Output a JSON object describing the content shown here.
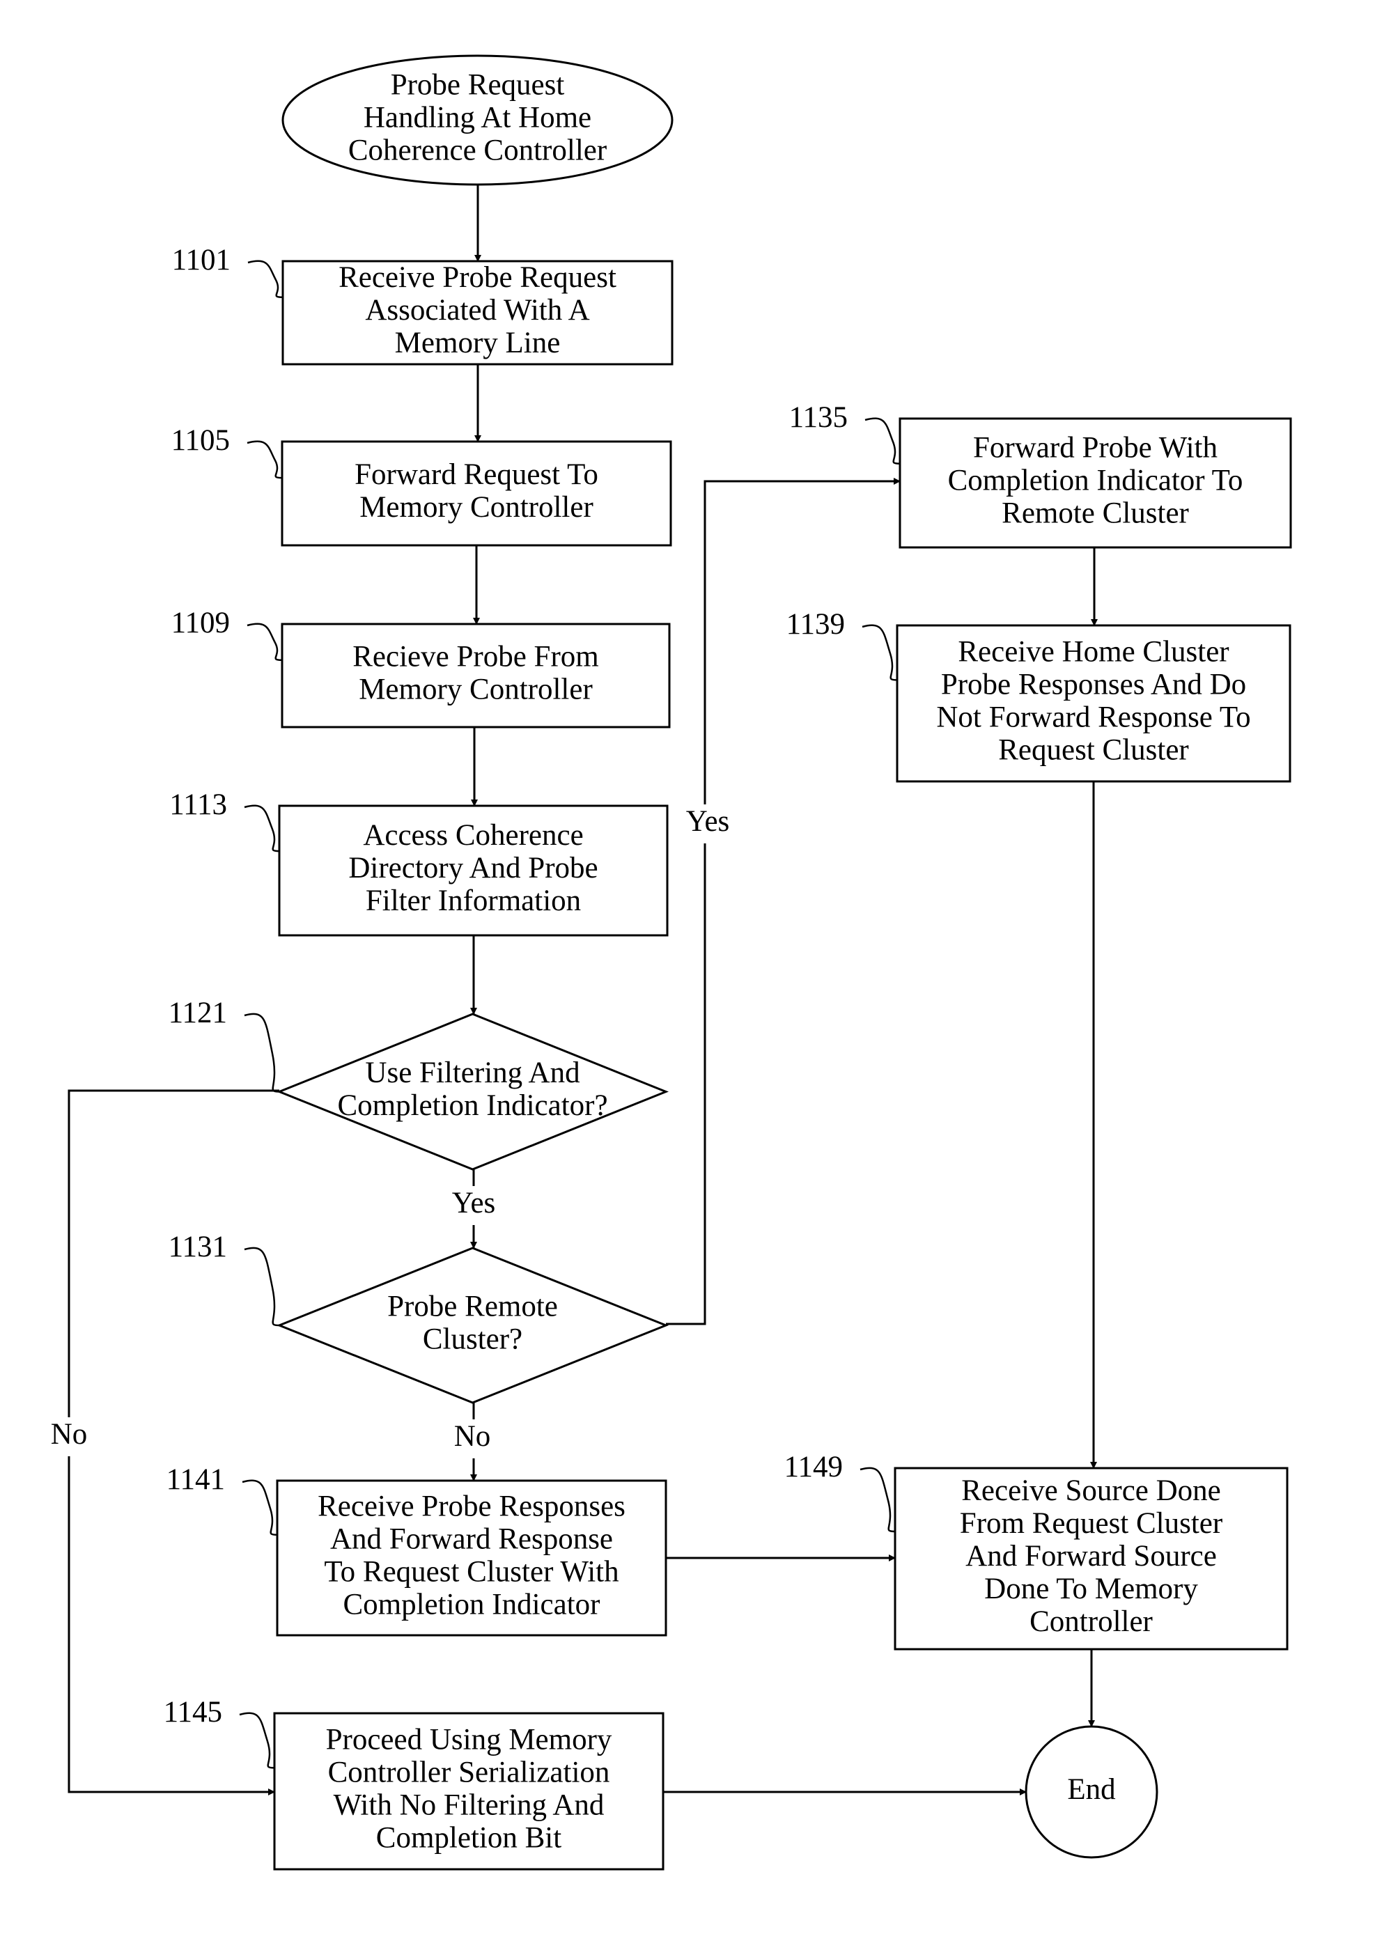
{
  "diagram": {
    "type": "flowchart",
    "nodes": [
      {
        "id": "start",
        "shape": "ellipse",
        "ref": "",
        "lines": [
          "Probe Request",
          "Handling At Home",
          "Coherence Controller"
        ]
      },
      {
        "id": "1101",
        "shape": "rect",
        "ref": "1101",
        "lines": [
          "Receive Probe Request",
          "Associated With A",
          "Memory Line"
        ]
      },
      {
        "id": "1105",
        "shape": "rect",
        "ref": "1105",
        "lines": [
          "Forward Request To",
          "Memory Controller"
        ]
      },
      {
        "id": "1109",
        "shape": "rect",
        "ref": "1109",
        "lines": [
          "Recieve Probe From",
          "Memory Controller"
        ]
      },
      {
        "id": "1113",
        "shape": "rect",
        "ref": "1113",
        "lines": [
          "Access Coherence",
          "Directory And Probe",
          "Filter Information"
        ]
      },
      {
        "id": "1121",
        "shape": "diamond",
        "ref": "1121",
        "lines": [
          "Use Filtering And",
          "Completion Indicator?"
        ]
      },
      {
        "id": "1131",
        "shape": "diamond",
        "ref": "1131",
        "lines": [
          "Probe Remote",
          "Cluster?"
        ]
      },
      {
        "id": "1135",
        "shape": "rect",
        "ref": "1135",
        "lines": [
          "Forward Probe With",
          "Completion Indicator To",
          "Remote Cluster"
        ]
      },
      {
        "id": "1139",
        "shape": "rect",
        "ref": "1139",
        "lines": [
          "Receive Home Cluster",
          "Probe Responses And Do",
          "Not Forward Response To",
          "Request Cluster"
        ]
      },
      {
        "id": "1141",
        "shape": "rect",
        "ref": "1141",
        "lines": [
          "Receive Probe Responses",
          "And Forward Response",
          "To Request Cluster With",
          "Completion Indicator"
        ]
      },
      {
        "id": "1145",
        "shape": "rect",
        "ref": "1145",
        "lines": [
          "Proceed Using Memory",
          "Controller Serialization",
          "With No Filtering And",
          "Completion Bit"
        ]
      },
      {
        "id": "1149",
        "shape": "rect",
        "ref": "1149",
        "lines": [
          "Receive Source Done",
          "From Request Cluster",
          "And Forward Source",
          "Done To Memory",
          "Controller"
        ]
      },
      {
        "id": "end",
        "shape": "circle",
        "ref": "",
        "lines": [
          "End"
        ]
      }
    ],
    "edges": [
      {
        "from": "start",
        "to": "1101",
        "label": ""
      },
      {
        "from": "1101",
        "to": "1105",
        "label": ""
      },
      {
        "from": "1105",
        "to": "1109",
        "label": ""
      },
      {
        "from": "1109",
        "to": "1113",
        "label": ""
      },
      {
        "from": "1113",
        "to": "1121",
        "label": ""
      },
      {
        "from": "1121",
        "to": "1131",
        "label": "Yes"
      },
      {
        "from": "1121",
        "to": "1145",
        "label": "No"
      },
      {
        "from": "1131",
        "to": "1135",
        "label": "Yes"
      },
      {
        "from": "1131",
        "to": "1141",
        "label": "No"
      },
      {
        "from": "1135",
        "to": "1139",
        "label": ""
      },
      {
        "from": "1139",
        "to": "1149",
        "label": ""
      },
      {
        "from": "1141",
        "to": "1149",
        "label": ""
      },
      {
        "from": "1145",
        "to": "end",
        "label": ""
      },
      {
        "from": "1149",
        "to": "end",
        "label": ""
      }
    ]
  }
}
